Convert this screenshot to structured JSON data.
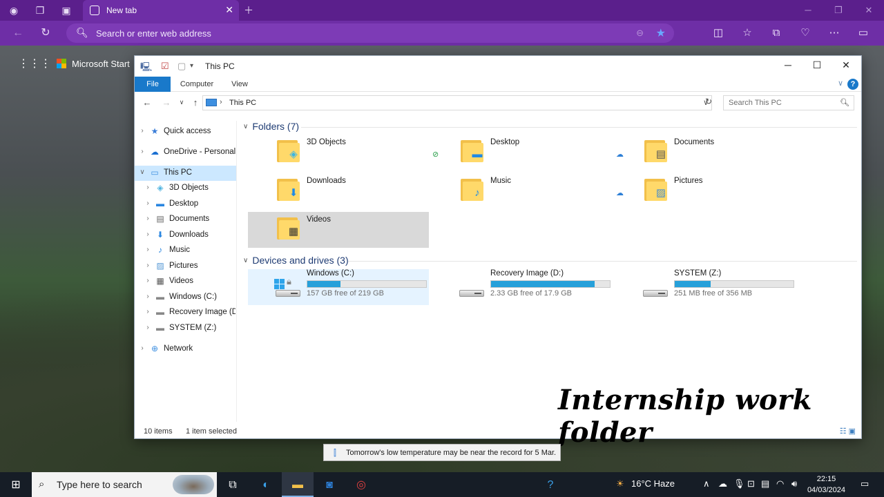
{
  "browser": {
    "tab_title": "New tab",
    "address_placeholder": "Search or enter web address"
  },
  "newtab": {
    "brand": "Microsoft Start"
  },
  "explorer": {
    "title": "This PC",
    "ribbon_tabs": [
      "File",
      "Computer",
      "View"
    ],
    "breadcrumb": "This PC",
    "search_placeholder": "Search This PC",
    "sidebar": [
      {
        "label": "Quick access",
        "icon": "star-icon",
        "level": 0
      },
      {
        "label": "OneDrive - Personal",
        "icon": "cloud-icon",
        "level": 0
      },
      {
        "label": "This PC",
        "icon": "computer-icon",
        "level": 0,
        "selected": true
      },
      {
        "label": "3D Objects",
        "icon": "cube-icon",
        "level": 1
      },
      {
        "label": "Desktop",
        "icon": "desktop-icon",
        "level": 1
      },
      {
        "label": "Documents",
        "icon": "document-icon",
        "level": 1
      },
      {
        "label": "Downloads",
        "icon": "download-icon",
        "level": 1
      },
      {
        "label": "Music",
        "icon": "music-icon",
        "level": 1
      },
      {
        "label": "Pictures",
        "icon": "picture-icon",
        "level": 1
      },
      {
        "label": "Videos",
        "icon": "video-icon",
        "level": 1
      },
      {
        "label": "Windows (C:)",
        "icon": "drive-icon",
        "level": 1
      },
      {
        "label": "Recovery Image (D:",
        "icon": "drive-icon",
        "level": 1
      },
      {
        "label": "SYSTEM (Z:)",
        "icon": "drive-icon",
        "level": 1
      },
      {
        "label": "Network",
        "icon": "network-icon",
        "level": 0
      }
    ],
    "folders_header": "Folders (7)",
    "folders": [
      {
        "name": "3D Objects",
        "badge": "cube-icon"
      },
      {
        "name": "Desktop",
        "badge": "desktop-icon"
      },
      {
        "name": "Documents",
        "badge": "document-icon"
      },
      {
        "name": "Downloads",
        "badge": "download-icon"
      },
      {
        "name": "Music",
        "badge": "music-icon"
      },
      {
        "name": "Pictures",
        "badge": "picture-icon"
      },
      {
        "name": "Videos",
        "badge": "video-icon"
      }
    ],
    "drives_header": "Devices and drives (3)",
    "drives": [
      {
        "name": "Windows (C:)",
        "free": "157 GB free of 219 GB",
        "used_fraction": 0.28
      },
      {
        "name": "Recovery Image (D:)",
        "free": "2.33 GB free of 17.9 GB",
        "used_fraction": 0.87
      },
      {
        "name": "SYSTEM (Z:)",
        "free": "251 MB free of 356 MB",
        "used_fraction": 0.3
      }
    ],
    "status_items": "10 items",
    "status_selected": "1 item selected"
  },
  "overlay_caption": "Internship work folder",
  "toast": "Tomorrow's low temperature may be near the record for 5 Mar.",
  "taskbar": {
    "search_placeholder": "Type here to search",
    "weather": "16°C  Haze",
    "time": "22:15",
    "date": "04/03/2024"
  },
  "colors": {
    "browser_tabbar": "#5b1f8c",
    "browser_toolbar": "#6e2ea6",
    "ribbon_file": "#1979ca",
    "drive_bar": "#26a0da",
    "selection": "#cce8ff"
  }
}
